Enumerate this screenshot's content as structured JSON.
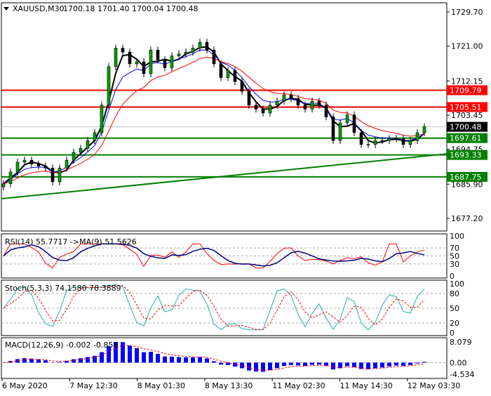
{
  "header": {
    "symbol": "XAUUSD,M30",
    "ohlc": "1700.18 1701.40 1700.04 1700.48"
  },
  "chart_data": {
    "type": "candlestick",
    "title": "XAUUSD,M30",
    "price_axis": {
      "ticks": [
        "1729.70",
        "1721.00",
        "1712.15",
        "1703.45",
        "1694.75",
        "1685.90",
        "1677.20"
      ],
      "range": [
        1677.2,
        1729.7
      ]
    },
    "closes": [
      1686,
      1689,
      1691.5,
      1692,
      1691,
      1690.5,
      1690,
      1686.5,
      1690,
      1692,
      1694,
      1695,
      1697,
      1699,
      1706,
      1715.8,
      1720.5,
      1719.5,
      1716.5,
      1717,
      1714,
      1720,
      1717.5,
      1715.5,
      1718.5,
      1719,
      1719.5,
      1720.5,
      1722,
      1720,
      1716.5,
      1713,
      1714.8,
      1712,
      1709.5,
      1706,
      1705,
      1704,
      1706,
      1707,
      1708.6,
      1707.7,
      1706,
      1705,
      1707,
      1706,
      1703,
      1697,
      1701.5,
      1703.5,
      1699,
      1696,
      1696,
      1697,
      1697,
      1697.5,
      1697.5,
      1696,
      1697,
      1699,
      1700.5
    ],
    "levels": [
      {
        "price": "1709.79",
        "color": "#ff0000",
        "type": "resistance"
      },
      {
        "price": "1705.51",
        "color": "#ff0000",
        "type": "resistance"
      },
      {
        "price": "1697.61",
        "color": "#008000",
        "type": "support"
      },
      {
        "price": "1693.33",
        "color": "#008000",
        "type": "support"
      },
      {
        "price": "1687.75",
        "color": "#008000",
        "type": "support"
      }
    ],
    "current_price": "1700.48",
    "trendline": {
      "start_price": 1682.2,
      "end_price": 1693.6,
      "color": "#008000"
    },
    "moving_averages": [
      {
        "color": "#000000"
      },
      {
        "color": "#0000ff"
      },
      {
        "color": "#ff0000"
      }
    ],
    "x_labels": [
      "6 May 2020",
      "7 May 12:30",
      "8 May 01:30",
      "8 May 13:30",
      "11 May 02:30",
      "11 May 14:30",
      "12 May 03:30"
    ],
    "rsi": {
      "label": "RSI(14) 55.7717  ->MA(9) 51.5626",
      "ticks": [
        "100",
        "70",
        "50",
        "30",
        "0"
      ]
    },
    "stoch": {
      "label": "Stoch(5,3,3) 74.1580 78.3889",
      "ticks": [
        "100",
        "80",
        "50",
        "20",
        "0"
      ]
    },
    "macd": {
      "label": "MACD(12,26,9) -0.002 -0.856",
      "ticks": [
        "8.079",
        "0.00",
        "-4.534"
      ],
      "range": [
        -4.534,
        8.079
      ]
    }
  }
}
